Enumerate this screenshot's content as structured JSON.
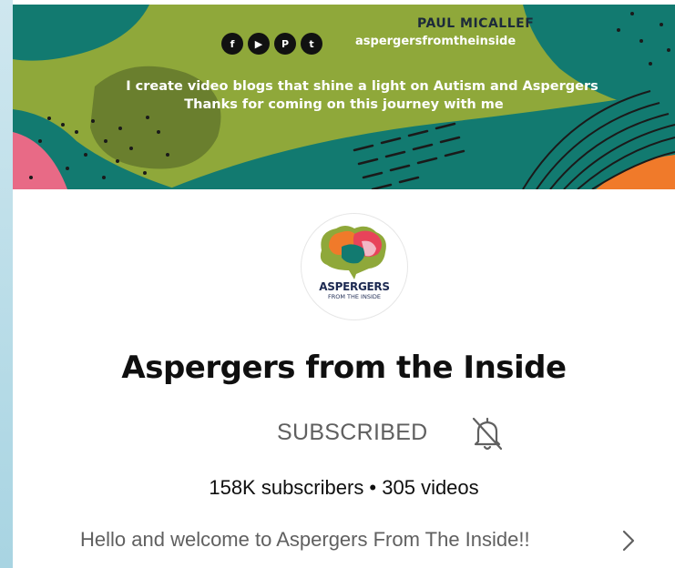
{
  "banner": {
    "name": "PAUL MICALLEF",
    "handle": "aspergersfromtheinside",
    "tagline_1": "I create video blogs that shine a light on Autism and Aspergers",
    "tagline_2": "Thanks for coming on this journey with me",
    "social_icons": [
      {
        "icon": "facebook-icon",
        "glyph": "f"
      },
      {
        "icon": "youtube-icon",
        "glyph": "▶"
      },
      {
        "icon": "patreon-icon",
        "glyph": "P"
      },
      {
        "icon": "twitter-icon",
        "glyph": "t"
      }
    ]
  },
  "avatar": {
    "line1": "ASPERGERS",
    "line2": "FROM THE INSIDE"
  },
  "channel": {
    "title": "Aspergers from the Inside",
    "subscribe_label": "SUBSCRIBED",
    "stats": "158K subscribers • 305 videos",
    "description": "Hello and welcome to Aspergers From The Inside!!"
  },
  "colors": {
    "banner_green": "#8fa83a",
    "banner_teal": "#127a70",
    "banner_dark_teal": "#0d5e58",
    "pink": "#e86a86",
    "orange": "#f07a2a",
    "text_primary": "#0f0f0f",
    "text_secondary": "#606060"
  }
}
